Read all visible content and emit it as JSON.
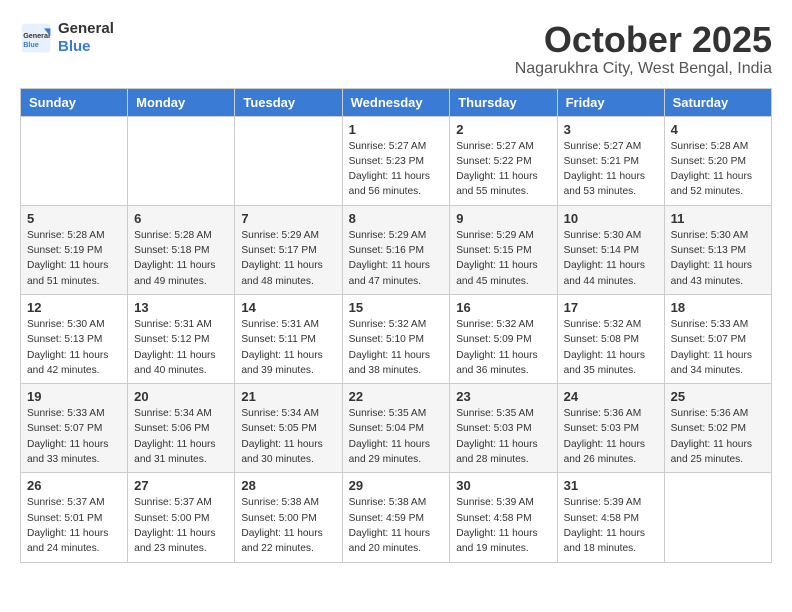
{
  "header": {
    "logo_general": "General",
    "logo_blue": "Blue",
    "month_title": "October 2025",
    "subtitle": "Nagarukhra City, West Bengal, India"
  },
  "days_of_week": [
    "Sunday",
    "Monday",
    "Tuesday",
    "Wednesday",
    "Thursday",
    "Friday",
    "Saturday"
  ],
  "weeks": [
    [
      {
        "day": "",
        "sunrise": "",
        "sunset": "",
        "daylight": ""
      },
      {
        "day": "",
        "sunrise": "",
        "sunset": "",
        "daylight": ""
      },
      {
        "day": "",
        "sunrise": "",
        "sunset": "",
        "daylight": ""
      },
      {
        "day": "1",
        "sunrise": "Sunrise: 5:27 AM",
        "sunset": "Sunset: 5:23 PM",
        "daylight": "Daylight: 11 hours and 56 minutes."
      },
      {
        "day": "2",
        "sunrise": "Sunrise: 5:27 AM",
        "sunset": "Sunset: 5:22 PM",
        "daylight": "Daylight: 11 hours and 55 minutes."
      },
      {
        "day": "3",
        "sunrise": "Sunrise: 5:27 AM",
        "sunset": "Sunset: 5:21 PM",
        "daylight": "Daylight: 11 hours and 53 minutes."
      },
      {
        "day": "4",
        "sunrise": "Sunrise: 5:28 AM",
        "sunset": "Sunset: 5:20 PM",
        "daylight": "Daylight: 11 hours and 52 minutes."
      }
    ],
    [
      {
        "day": "5",
        "sunrise": "Sunrise: 5:28 AM",
        "sunset": "Sunset: 5:19 PM",
        "daylight": "Daylight: 11 hours and 51 minutes."
      },
      {
        "day": "6",
        "sunrise": "Sunrise: 5:28 AM",
        "sunset": "Sunset: 5:18 PM",
        "daylight": "Daylight: 11 hours and 49 minutes."
      },
      {
        "day": "7",
        "sunrise": "Sunrise: 5:29 AM",
        "sunset": "Sunset: 5:17 PM",
        "daylight": "Daylight: 11 hours and 48 minutes."
      },
      {
        "day": "8",
        "sunrise": "Sunrise: 5:29 AM",
        "sunset": "Sunset: 5:16 PM",
        "daylight": "Daylight: 11 hours and 47 minutes."
      },
      {
        "day": "9",
        "sunrise": "Sunrise: 5:29 AM",
        "sunset": "Sunset: 5:15 PM",
        "daylight": "Daylight: 11 hours and 45 minutes."
      },
      {
        "day": "10",
        "sunrise": "Sunrise: 5:30 AM",
        "sunset": "Sunset: 5:14 PM",
        "daylight": "Daylight: 11 hours and 44 minutes."
      },
      {
        "day": "11",
        "sunrise": "Sunrise: 5:30 AM",
        "sunset": "Sunset: 5:13 PM",
        "daylight": "Daylight: 11 hours and 43 minutes."
      }
    ],
    [
      {
        "day": "12",
        "sunrise": "Sunrise: 5:30 AM",
        "sunset": "Sunset: 5:13 PM",
        "daylight": "Daylight: 11 hours and 42 minutes."
      },
      {
        "day": "13",
        "sunrise": "Sunrise: 5:31 AM",
        "sunset": "Sunset: 5:12 PM",
        "daylight": "Daylight: 11 hours and 40 minutes."
      },
      {
        "day": "14",
        "sunrise": "Sunrise: 5:31 AM",
        "sunset": "Sunset: 5:11 PM",
        "daylight": "Daylight: 11 hours and 39 minutes."
      },
      {
        "day": "15",
        "sunrise": "Sunrise: 5:32 AM",
        "sunset": "Sunset: 5:10 PM",
        "daylight": "Daylight: 11 hours and 38 minutes."
      },
      {
        "day": "16",
        "sunrise": "Sunrise: 5:32 AM",
        "sunset": "Sunset: 5:09 PM",
        "daylight": "Daylight: 11 hours and 36 minutes."
      },
      {
        "day": "17",
        "sunrise": "Sunrise: 5:32 AM",
        "sunset": "Sunset: 5:08 PM",
        "daylight": "Daylight: 11 hours and 35 minutes."
      },
      {
        "day": "18",
        "sunrise": "Sunrise: 5:33 AM",
        "sunset": "Sunset: 5:07 PM",
        "daylight": "Daylight: 11 hours and 34 minutes."
      }
    ],
    [
      {
        "day": "19",
        "sunrise": "Sunrise: 5:33 AM",
        "sunset": "Sunset: 5:07 PM",
        "daylight": "Daylight: 11 hours and 33 minutes."
      },
      {
        "day": "20",
        "sunrise": "Sunrise: 5:34 AM",
        "sunset": "Sunset: 5:06 PM",
        "daylight": "Daylight: 11 hours and 31 minutes."
      },
      {
        "day": "21",
        "sunrise": "Sunrise: 5:34 AM",
        "sunset": "Sunset: 5:05 PM",
        "daylight": "Daylight: 11 hours and 30 minutes."
      },
      {
        "day": "22",
        "sunrise": "Sunrise: 5:35 AM",
        "sunset": "Sunset: 5:04 PM",
        "daylight": "Daylight: 11 hours and 29 minutes."
      },
      {
        "day": "23",
        "sunrise": "Sunrise: 5:35 AM",
        "sunset": "Sunset: 5:03 PM",
        "daylight": "Daylight: 11 hours and 28 minutes."
      },
      {
        "day": "24",
        "sunrise": "Sunrise: 5:36 AM",
        "sunset": "Sunset: 5:03 PM",
        "daylight": "Daylight: 11 hours and 26 minutes."
      },
      {
        "day": "25",
        "sunrise": "Sunrise: 5:36 AM",
        "sunset": "Sunset: 5:02 PM",
        "daylight": "Daylight: 11 hours and 25 minutes."
      }
    ],
    [
      {
        "day": "26",
        "sunrise": "Sunrise: 5:37 AM",
        "sunset": "Sunset: 5:01 PM",
        "daylight": "Daylight: 11 hours and 24 minutes."
      },
      {
        "day": "27",
        "sunrise": "Sunrise: 5:37 AM",
        "sunset": "Sunset: 5:00 PM",
        "daylight": "Daylight: 11 hours and 23 minutes."
      },
      {
        "day": "28",
        "sunrise": "Sunrise: 5:38 AM",
        "sunset": "Sunset: 5:00 PM",
        "daylight": "Daylight: 11 hours and 22 minutes."
      },
      {
        "day": "29",
        "sunrise": "Sunrise: 5:38 AM",
        "sunset": "Sunset: 4:59 PM",
        "daylight": "Daylight: 11 hours and 20 minutes."
      },
      {
        "day": "30",
        "sunrise": "Sunrise: 5:39 AM",
        "sunset": "Sunset: 4:58 PM",
        "daylight": "Daylight: 11 hours and 19 minutes."
      },
      {
        "day": "31",
        "sunrise": "Sunrise: 5:39 AM",
        "sunset": "Sunset: 4:58 PM",
        "daylight": "Daylight: 11 hours and 18 minutes."
      },
      {
        "day": "",
        "sunrise": "",
        "sunset": "",
        "daylight": ""
      }
    ]
  ]
}
